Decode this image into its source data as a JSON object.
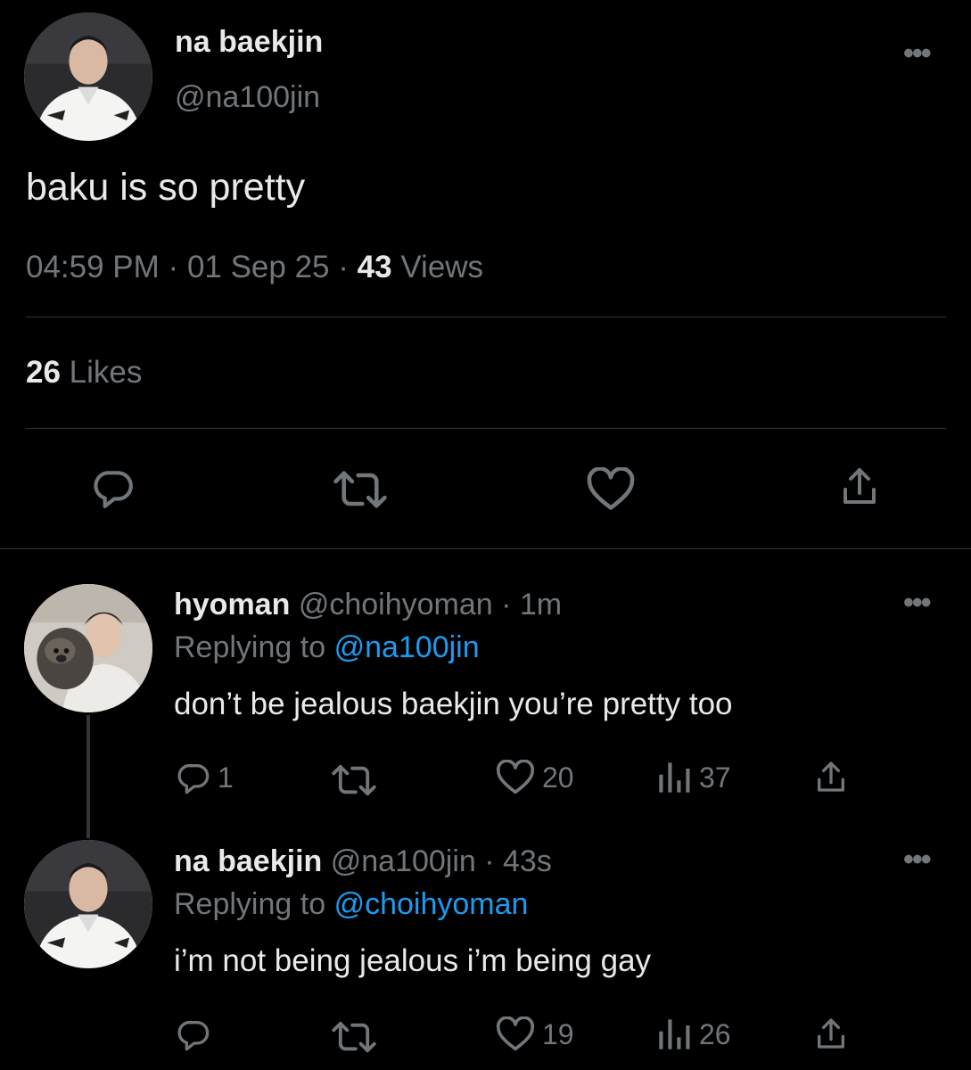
{
  "main_tweet": {
    "display_name": "na baekjin",
    "handle": "@na100jin",
    "text": "baku is so pretty",
    "time": "04:59 PM",
    "date": "01 Sep 25",
    "views_count": "43",
    "views_label": "Views",
    "likes_count": "26",
    "likes_label": "Likes"
  },
  "replies": [
    {
      "display_name": "hyoman",
      "meta": "@choihyoman · 1m",
      "replying_prefix": "Replying to",
      "replying_to": "@na100jin",
      "text": "don’t be jealous baekjin you’re pretty too",
      "reply_count": "1",
      "like_count": "20",
      "view_count": "37"
    },
    {
      "display_name": "na baekjin",
      "meta": "@na100jin · 43s",
      "replying_prefix": "Replying to",
      "replying_to": "@choihyoman",
      "text": "i’m not being jealous i’m being gay",
      "reply_count": "",
      "like_count": "19",
      "view_count": "26"
    }
  ],
  "theme": {
    "background": "#000000",
    "text": "#e7e9ea",
    "muted": "#71767b",
    "accent": "#1d9bf0",
    "divider": "#2f3336"
  }
}
